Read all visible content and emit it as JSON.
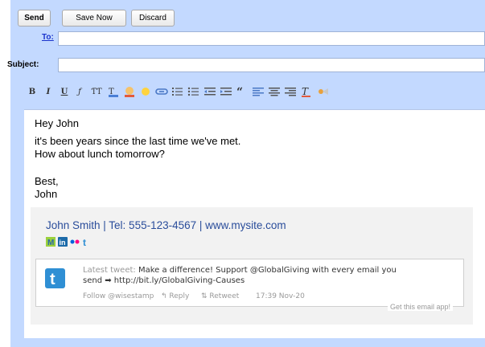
{
  "toolbar": {
    "send_label": "Send",
    "save_label": "Save Now",
    "discard_label": "Discard"
  },
  "fields": {
    "to_label": "To:",
    "to_value": "",
    "subject_label": "Subject:",
    "subject_value": ""
  },
  "format_toolbar": {
    "bold": "B",
    "italic": "I",
    "underline": "U",
    "font": "ƒ",
    "size": "ƬƬ",
    "text_color": "T",
    "icons": [
      "bold-icon",
      "italic-icon",
      "underline-icon",
      "font-family-icon",
      "font-size-icon",
      "text-color-icon",
      "highlight-icon",
      "emoticon-icon",
      "link-icon",
      "numbered-list-icon",
      "bulleted-list-icon",
      "indent-less-icon",
      "indent-more-icon",
      "quote-icon",
      "align-left-icon",
      "align-center-icon",
      "align-right-icon",
      "remove-formatting-icon",
      "spell-check-icon"
    ]
  },
  "message": {
    "greeting": "Hey John",
    "line1": "it's been years since the last time we've met.",
    "line2": "How about lunch tomorrow?",
    "closing": "Best,",
    "sender": "John"
  },
  "signature": {
    "line": "John Smith | Tel: 555-123-4567 | www.mysite.com",
    "social_icons": [
      "myspace-icon",
      "linkedin-icon",
      "flickr-icon",
      "twitter-icon"
    ],
    "tweet_prefix": "Latest tweet:",
    "tweet_text": "Make a difference! Support @GlobalGiving with every email you",
    "tweet_text2": "send ➡ http://bit.ly/GlobalGiving-Causes",
    "follow": "Follow @wisestamp",
    "reply": "Reply",
    "retweet": "Retweet",
    "time": "17:39 Nov-20",
    "get_app": "Get this email app!"
  },
  "colors": {
    "panel": "#c3d9ff",
    "link": "#1a33cc",
    "signature_text": "#2a4d9b",
    "twitter": "#2f8fd4"
  }
}
